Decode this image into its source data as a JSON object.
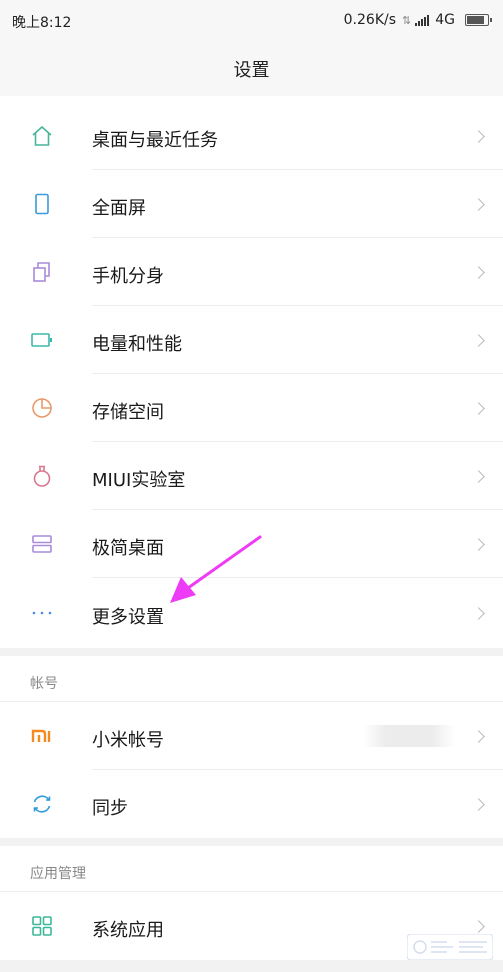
{
  "status_bar": {
    "time": "晚上8:12",
    "speed": "0.26K/s",
    "network": "4G",
    "battery_level": 0.85
  },
  "header": {
    "title": "设置"
  },
  "items": [
    {
      "label": "桌面与最近任务",
      "icon": "home-icon",
      "color": "#47b59a"
    },
    {
      "label": "全面屏",
      "icon": "phone-icon",
      "color": "#3a9bdc"
    },
    {
      "label": "手机分身",
      "icon": "clone-icon",
      "color": "#a98bd9"
    },
    {
      "label": "电量和性能",
      "icon": "battery-icon",
      "color": "#3bb8a8"
    },
    {
      "label": "存储空间",
      "icon": "pie-icon",
      "color": "#e69a6c"
    },
    {
      "label": "MIUI实验室",
      "icon": "flask-icon",
      "color": "#d8788f"
    },
    {
      "label": "极简桌面",
      "icon": "layout-icon",
      "color": "#a98bd9"
    },
    {
      "label": "更多设置",
      "icon": "more-icon",
      "color": "#4a8fe0"
    }
  ],
  "sections": [
    {
      "header": "帐号",
      "items": [
        {
          "label": "小米帐号",
          "icon": "mi-icon",
          "color": "#f58a1f"
        },
        {
          "label": "同步",
          "icon": "sync-icon",
          "color": "#2f9bd8"
        }
      ]
    },
    {
      "header": "应用管理",
      "items": [
        {
          "label": "系统应用",
          "icon": "apps-icon",
          "color": "#3bb89a"
        }
      ]
    }
  ],
  "colors": {
    "annotation_arrow": "#ee3bf5"
  }
}
